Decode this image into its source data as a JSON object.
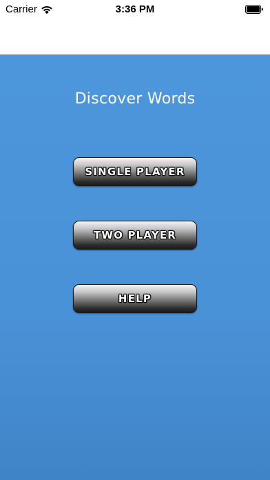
{
  "status_bar": {
    "carrier": "Carrier",
    "time": "3:36 PM",
    "wifi_icon": "wifi-icon",
    "battery_icon": "battery-icon"
  },
  "main": {
    "background_color": "#4a92d8",
    "title": "Discover Words",
    "buttons": [
      {
        "label": "SINGLE PLAYER"
      },
      {
        "label": "TWO PLAYER"
      },
      {
        "label": "HELP"
      }
    ]
  }
}
